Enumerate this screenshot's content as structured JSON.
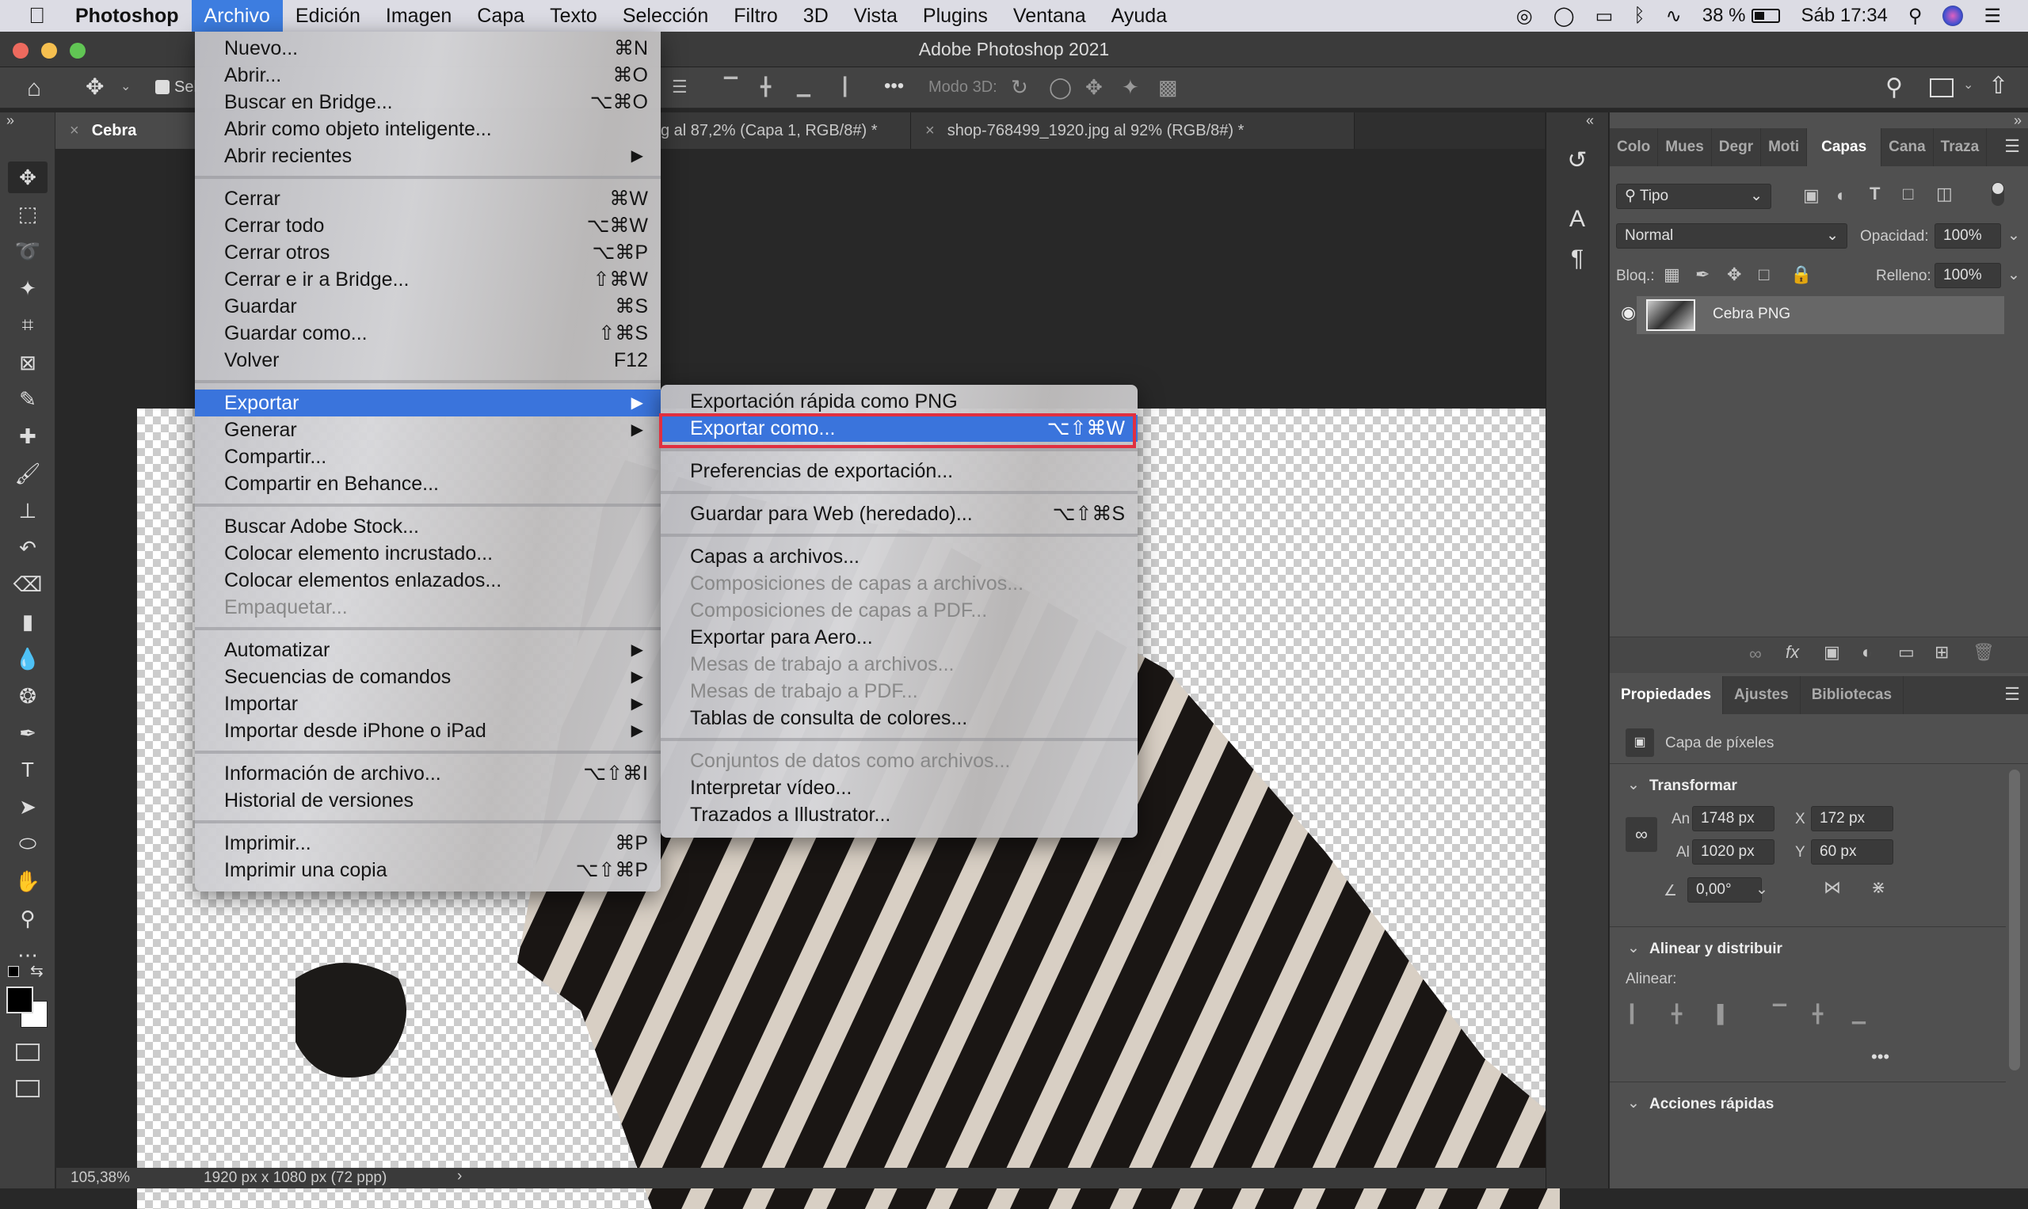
{
  "menubar": {
    "apple_icon": "apple-logo",
    "items": [
      "Photoshop",
      "Archivo",
      "Edición",
      "Imagen",
      "Capa",
      "Texto",
      "Selección",
      "Filtro",
      "3D",
      "Vista",
      "Plugins",
      "Ventana",
      "Ayuda"
    ],
    "active": "Archivo",
    "battery": "38 %",
    "clock": "Sáb 17:34"
  },
  "window": {
    "title": "Adobe Photoshop 2021"
  },
  "options_bar": {
    "auto_select_label": "Sel",
    "mode_3d_label": "Modo 3D:"
  },
  "tabs": [
    {
      "label": "Cebra PNG.ps",
      "active": true
    },
    {
      "label": "g al 87,2% (Capa 1, RGB/8#) *",
      "active": false
    },
    {
      "label": "shop-768499_1920.jpg al 92% (RGB/8#) *",
      "active": false
    }
  ],
  "file_menu": {
    "groups": [
      [
        {
          "label": "Nuevo...",
          "shortcut": "⌘N"
        },
        {
          "label": "Abrir...",
          "shortcut": "⌘O"
        },
        {
          "label": "Buscar en Bridge...",
          "shortcut": "⌥⌘O"
        },
        {
          "label": "Abrir como objeto inteligente...",
          "shortcut": ""
        },
        {
          "label": "Abrir recientes",
          "submenu": true
        }
      ],
      [
        {
          "label": "Cerrar",
          "shortcut": "⌘W"
        },
        {
          "label": "Cerrar todo",
          "shortcut": "⌥⌘W"
        },
        {
          "label": "Cerrar otros",
          "shortcut": "⌥⌘P"
        },
        {
          "label": "Cerrar e ir a Bridge...",
          "shortcut": "⇧⌘W"
        },
        {
          "label": "Guardar",
          "shortcut": "⌘S"
        },
        {
          "label": "Guardar como...",
          "shortcut": "⇧⌘S"
        },
        {
          "label": "Volver",
          "shortcut": "F12"
        }
      ],
      [
        {
          "label": "Exportar",
          "submenu": true,
          "highlighted": true
        },
        {
          "label": "Generar",
          "submenu": true
        },
        {
          "label": "Compartir...",
          "shortcut": ""
        },
        {
          "label": "Compartir en Behance...",
          "shortcut": ""
        }
      ],
      [
        {
          "label": "Buscar Adobe Stock...",
          "shortcut": ""
        },
        {
          "label": "Colocar elemento incrustado...",
          "shortcut": ""
        },
        {
          "label": "Colocar elementos enlazados...",
          "shortcut": ""
        },
        {
          "label": "Empaquetar...",
          "disabled": true
        }
      ],
      [
        {
          "label": "Automatizar",
          "submenu": true
        },
        {
          "label": "Secuencias de comandos",
          "submenu": true
        },
        {
          "label": "Importar",
          "submenu": true
        },
        {
          "label": "Importar desde iPhone o iPad",
          "submenu": true
        }
      ],
      [
        {
          "label": "Información de archivo...",
          "shortcut": "⌥⇧⌘I"
        },
        {
          "label": "Historial de versiones",
          "shortcut": ""
        }
      ],
      [
        {
          "label": "Imprimir...",
          "shortcut": "⌘P"
        },
        {
          "label": "Imprimir una copia",
          "shortcut": "⌥⇧⌘P"
        }
      ]
    ]
  },
  "export_submenu": {
    "groups": [
      [
        {
          "label": "Exportación rápida como PNG",
          "shortcut": ""
        },
        {
          "label": "Exportar como...",
          "shortcut": "⌥⇧⌘W",
          "highlighted": true
        }
      ],
      [
        {
          "label": "Preferencias de exportación...",
          "shortcut": ""
        }
      ],
      [
        {
          "label": "Guardar para Web (heredado)...",
          "shortcut": "⌥⇧⌘S"
        }
      ],
      [
        {
          "label": "Capas a archivos...",
          "shortcut": ""
        },
        {
          "label": "Composiciones de capas a archivos...",
          "disabled": true
        },
        {
          "label": "Composiciones de capas a PDF...",
          "disabled": true
        },
        {
          "label": "Exportar para Aero...",
          "shortcut": ""
        },
        {
          "label": "Mesas de trabajo a archivos...",
          "disabled": true
        },
        {
          "label": "Mesas de trabajo a PDF...",
          "disabled": true
        },
        {
          "label": "Tablas de consulta de colores...",
          "shortcut": ""
        }
      ],
      [
        {
          "label": "Conjuntos de datos como archivos...",
          "disabled": true
        },
        {
          "label": "Interpretar vídeo...",
          "shortcut": ""
        },
        {
          "label": "Trazados a Illustrator...",
          "shortcut": ""
        }
      ]
    ]
  },
  "layers_panel": {
    "tabs": [
      "Colo",
      "Mues",
      "Degr",
      "Moti",
      "Capas",
      "Cana",
      "Traza"
    ],
    "active_tab": "Capas",
    "filter_label": "Tipo",
    "blend_mode": "Normal",
    "opacity_label": "Opacidad:",
    "opacity_value": "100%",
    "lock_label": "Bloq.:",
    "fill_label": "Relleno:",
    "fill_value": "100%",
    "layers": [
      {
        "name": "Cebra PNG",
        "visible": true
      }
    ]
  },
  "properties_panel": {
    "tabs": [
      "Propiedades",
      "Ajustes",
      "Bibliotecas"
    ],
    "active_tab": "Propiedades",
    "layer_type": "Capa de píxeles",
    "transform_header": "Transformar",
    "width_label": "An",
    "width_value": "1748 px",
    "height_label": "Al",
    "height_value": "1020 px",
    "x_label": "X",
    "x_value": "172 px",
    "y_label": "Y",
    "y_value": "60 px",
    "angle_value": "0,00°",
    "align_header": "Alinear y distribuir",
    "align_label": "Alinear:",
    "quick_actions_header": "Acciones rápidas"
  },
  "status": {
    "zoom": "105,38%",
    "doc_info": "1920 px x 1080 px (72 ppp)"
  },
  "colors": {
    "highlight": "#3a74dc",
    "annotation_box": "#e03040"
  }
}
